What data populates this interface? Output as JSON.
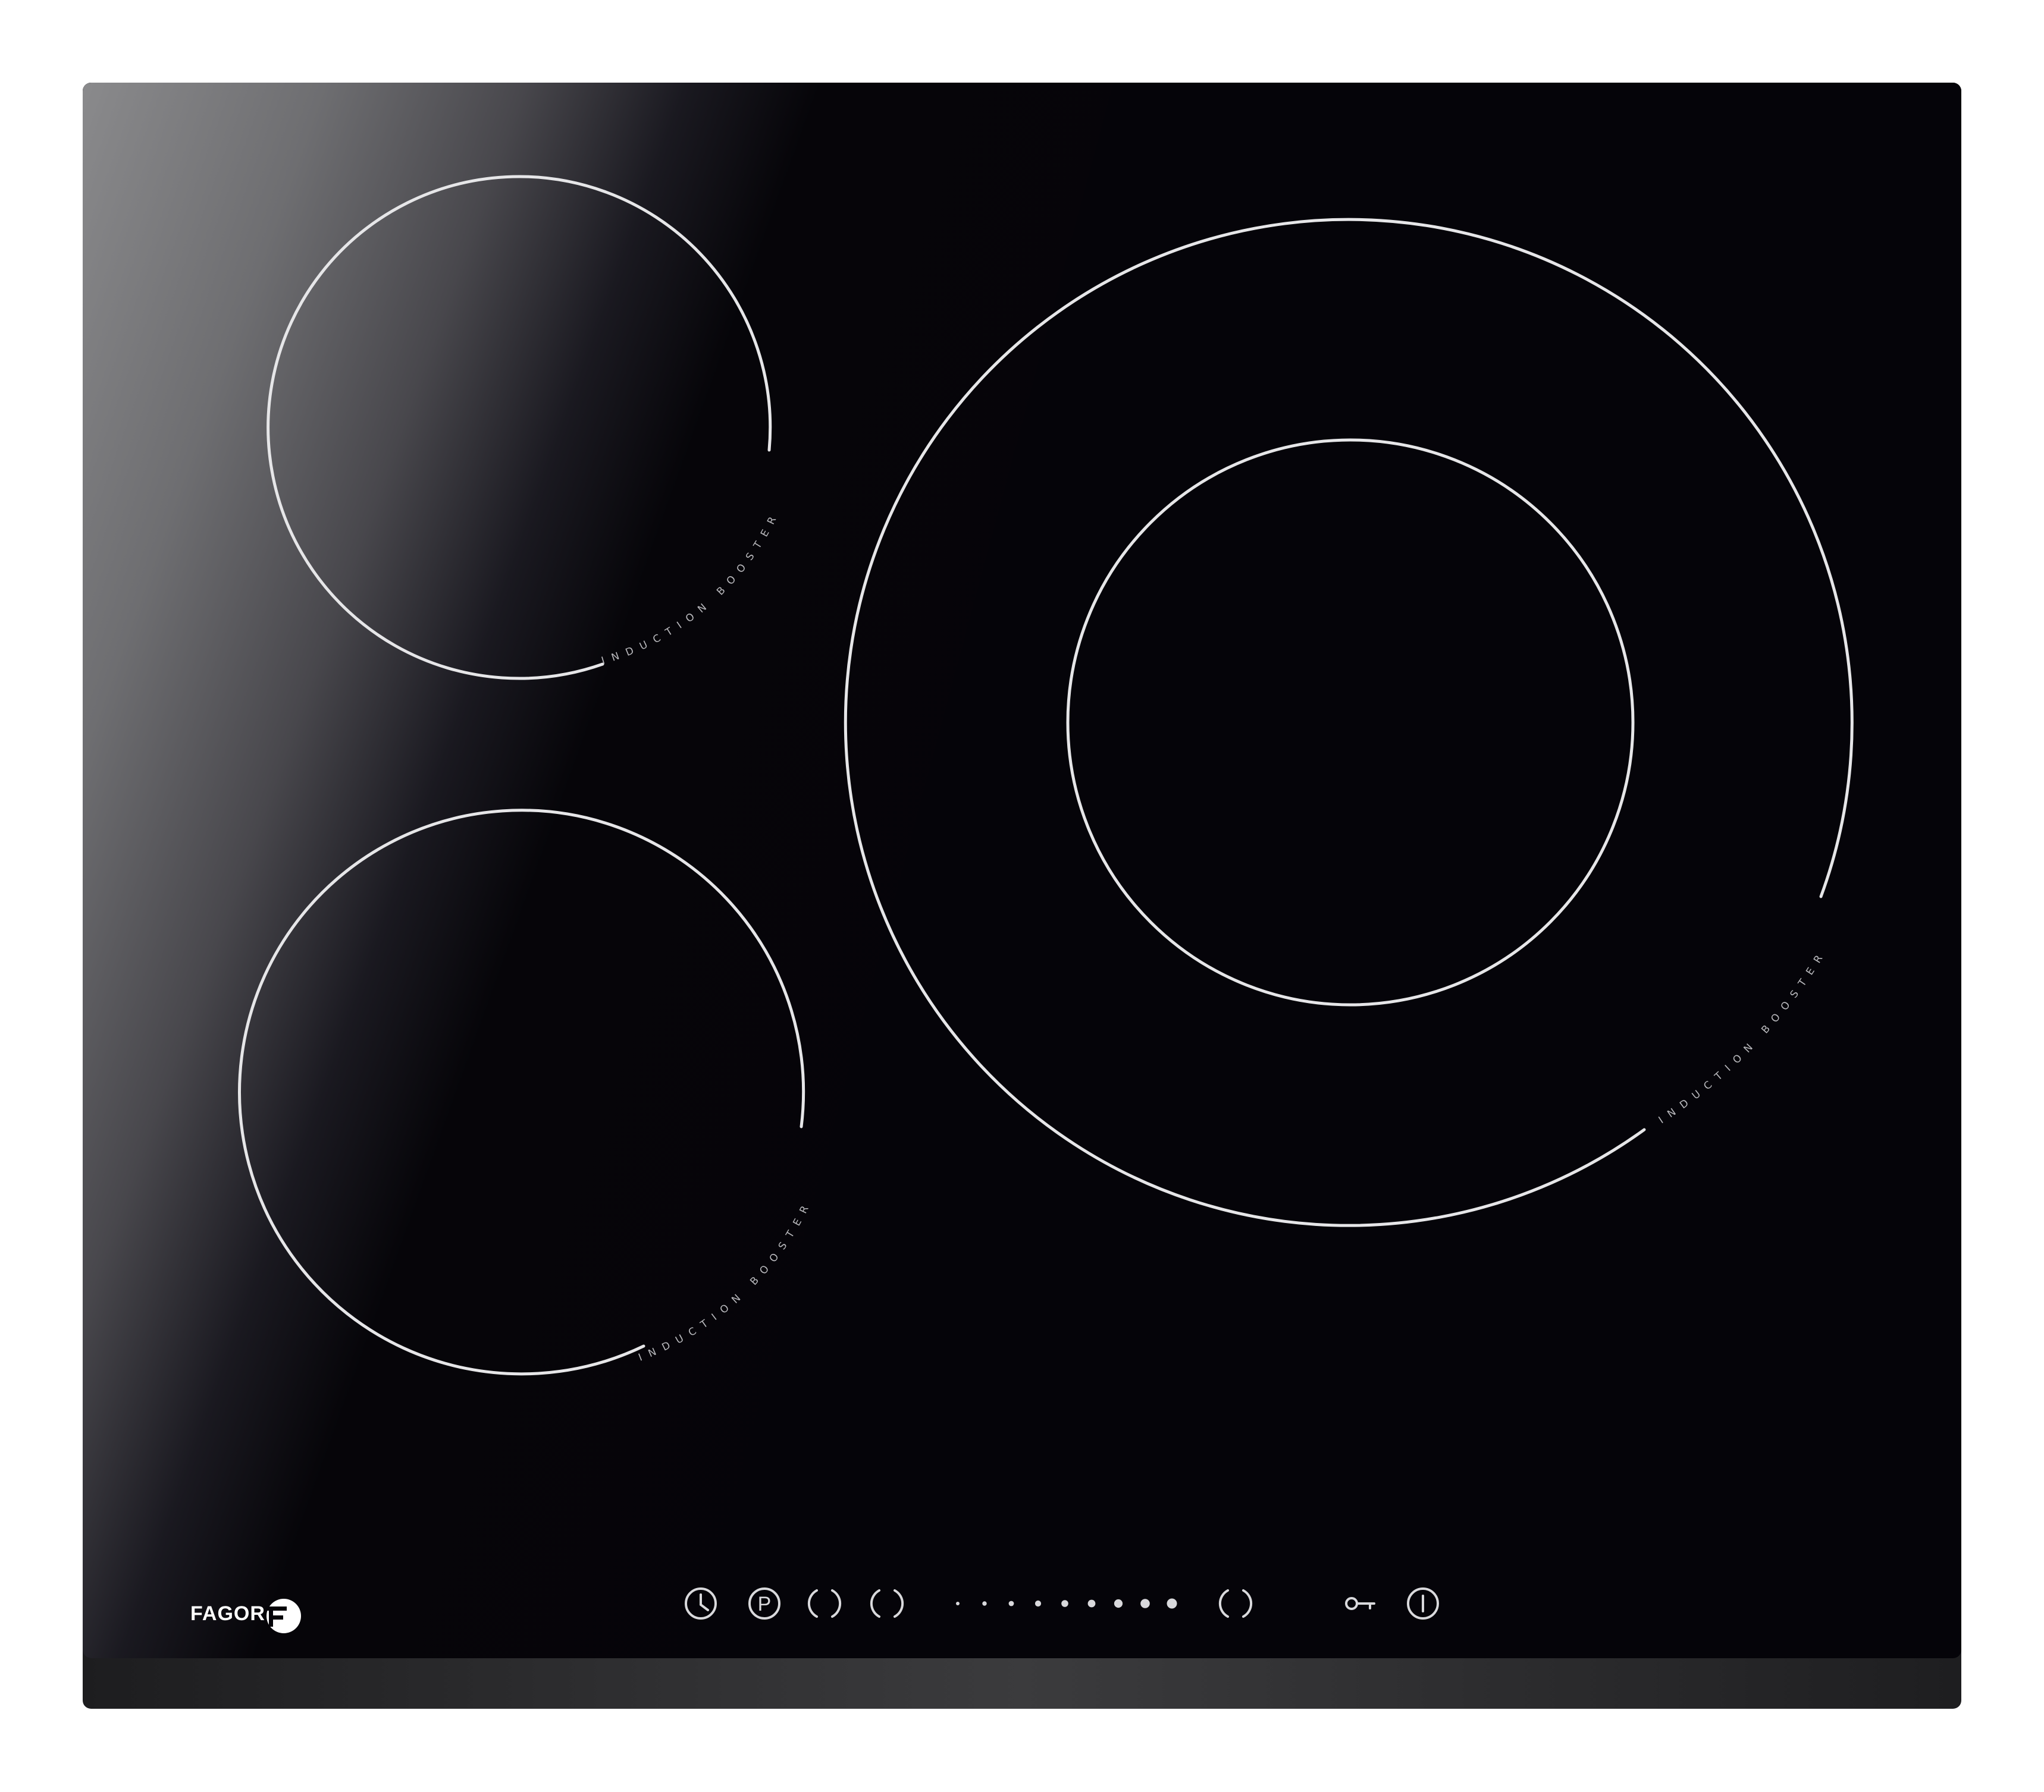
{
  "brand": {
    "name": "FAGOR",
    "logo_icon": "fagor-f-disc-icon"
  },
  "zones": [
    {
      "id": "top-left",
      "label": "INDUCTION BOOSTER"
    },
    {
      "id": "bottom-left",
      "label": "INDUCTION BOOSTER"
    },
    {
      "id": "large-right",
      "label": "INDUCTION BOOSTER"
    }
  ],
  "controls": {
    "timer_icon": "clock-icon",
    "program_label": "P",
    "zone_select_icons": [
      "split-ring-icon",
      "split-ring-icon"
    ],
    "slider_steps": 9,
    "boost_icon": "split-ring-icon",
    "lock_icon": "key-icon",
    "power_icon": "power-icon"
  },
  "colors": {
    "glass": "#050409",
    "frame": "#2a2a2c",
    "lines": "#e6e6e8"
  }
}
